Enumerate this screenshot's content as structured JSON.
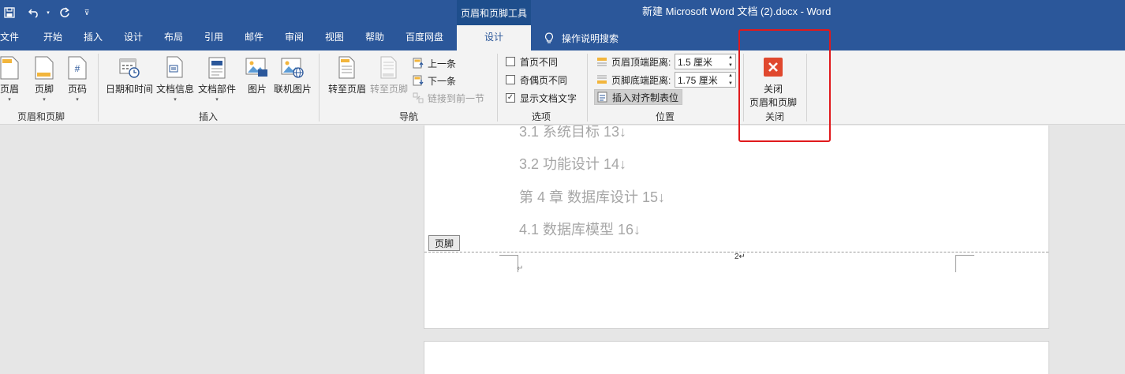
{
  "titlebar": {
    "context_tab_title": "页眉和页脚工具",
    "document_title": "新建 Microsoft Word 文档 (2).docx  -  Word"
  },
  "tabs": {
    "file": "文件",
    "home": "开始",
    "insert": "插入",
    "design": "设计",
    "layout": "布局",
    "references": "引用",
    "mailings": "邮件",
    "review": "审阅",
    "view": "视图",
    "help": "帮助",
    "baidu": "百度网盘",
    "hf_design": "设计",
    "tell_me": "操作说明搜索"
  },
  "ribbon": {
    "hf_group": {
      "header": "页眉",
      "footer": "页脚",
      "page_number": "页码",
      "label": "页眉和页脚"
    },
    "insert_group": {
      "date_time": "日期和时间",
      "doc_info": "文档信息",
      "quick_parts": "文档部件",
      "pictures": "图片",
      "online_pictures": "联机图片",
      "label": "插入"
    },
    "nav_group": {
      "goto_header": "转至页眉",
      "goto_footer": "转至页脚",
      "previous": "上一条",
      "next": "下一条",
      "link_previous": "链接到前一节",
      "label": "导航"
    },
    "options_group": {
      "diff_first": "首页不同",
      "diff_odd_even": "奇偶页不同",
      "show_doc_text": "显示文档文字",
      "label": "选项"
    },
    "position_group": {
      "header_from_top_label": "页眉顶端距离:",
      "header_from_top_value": "1.5 厘米",
      "footer_from_bottom_label": "页脚底端距离:",
      "footer_from_bottom_value": "1.75 厘米",
      "insert_align_tab": "插入对齐制表位",
      "label": "位置"
    },
    "close_group": {
      "close_line1": "关闭",
      "close_line2": "页眉和页脚",
      "label": "关闭"
    }
  },
  "document": {
    "toc": [
      "3.1  系统目标 13↓",
      "3.2 功能设计 14↓",
      "第 4 章  数据库设计 15↓",
      "4.1  数据库模型 16↓"
    ],
    "footer_tag": "页脚",
    "page_number": "2↵",
    "para_mark": "↵"
  },
  "colors": {
    "word_blue": "#2b579a",
    "close_red": "#e0482e",
    "annotation_red": "#e0191c"
  }
}
